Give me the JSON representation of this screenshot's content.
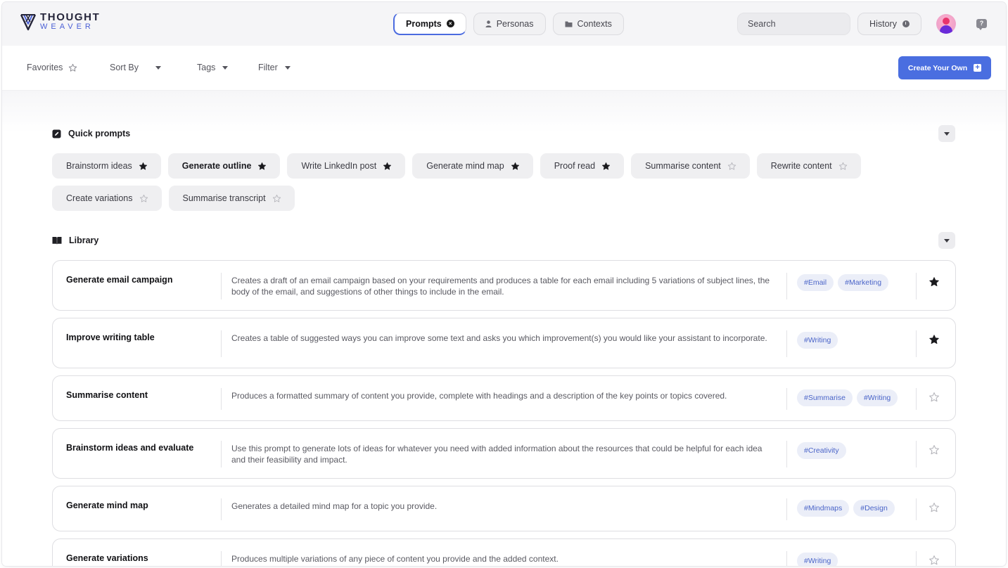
{
  "app": {
    "logo_line1": "THOUGHT",
    "logo_line2": "WEAVER",
    "accent": "#4a6ee0"
  },
  "header": {
    "tabs": [
      {
        "label": "Prompts",
        "active": true,
        "icon": "close-circle-icon"
      },
      {
        "label": "Personas",
        "active": false,
        "icon": "person-icon"
      },
      {
        "label": "Contexts",
        "active": false,
        "icon": "folder-icon"
      }
    ],
    "search_placeholder": "Search",
    "history_label": "History"
  },
  "filters": {
    "favorites": "Favorites",
    "sort_by": "Sort By",
    "tags": "Tags",
    "filter": "Filter",
    "create_label": "Create Your Own"
  },
  "quick_prompts": {
    "title": "Quick prompts",
    "chips": [
      {
        "label": "Brainstorm ideas",
        "starred": true
      },
      {
        "label": "Generate outline",
        "starred": true
      },
      {
        "label": "Write LinkedIn post",
        "starred": true
      },
      {
        "label": "Generate mind map",
        "starred": true
      },
      {
        "label": "Proof read",
        "starred": true
      },
      {
        "label": "Summarise content",
        "starred": false
      },
      {
        "label": "Rewrite content",
        "starred": false
      },
      {
        "label": "Create variations",
        "starred": false
      },
      {
        "label": "Summarise transcript",
        "starred": false
      }
    ]
  },
  "library": {
    "title": "Library",
    "items": [
      {
        "title": "Generate email campaign",
        "description": "Creates a draft of an email campaign based on your requirements and produces a table for each email including 5 variations of subject lines, the body of the email, and suggestions of other things to include in the email.",
        "tags": [
          "#Email",
          "#Marketing"
        ],
        "starred": true
      },
      {
        "title": "Improve writing table",
        "description": "Creates a table of suggested ways you can improve some text and asks you which improvement(s) you would like your assistant to incorporate.",
        "tags": [
          "#Writing"
        ],
        "starred": true
      },
      {
        "title": "Summarise content",
        "description": "Produces a formatted summary of content you provide, complete with headings and a description of the key points or topics covered.",
        "tags": [
          "#Summarise",
          "#Writing"
        ],
        "starred": false
      },
      {
        "title": "Brainstorm ideas and evaluate",
        "description": "Use this prompt to generate lots of ideas for whatever you need with added information about the resources that could be helpful for each idea and their feasibility and impact.",
        "tags": [
          "#Creativity"
        ],
        "starred": false
      },
      {
        "title": "Generate mind map",
        "description": "Generates a detailed mind map for a topic you provide.",
        "tags": [
          "#Mindmaps",
          "#Design"
        ],
        "starred": false
      },
      {
        "title": "Generate variations",
        "description": "Produces multiple variations of any piece of content you provide and the added context.",
        "tags": [
          "#Writing"
        ],
        "starred": false
      }
    ]
  }
}
